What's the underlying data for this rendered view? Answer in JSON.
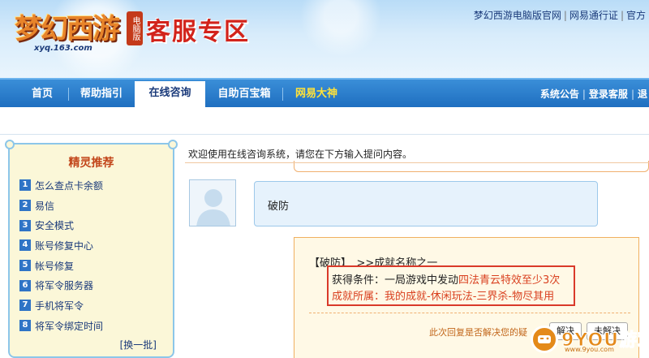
{
  "header": {
    "logo_text": "梦幻西游",
    "logo_badge": "电脑版",
    "logo_url": "xyq.163.com",
    "section_title": "客服专区",
    "top_links": [
      "梦幻西游电脑版官网",
      "网易通行证",
      "官方"
    ]
  },
  "nav": {
    "items": [
      "首页",
      "帮助指引",
      "在线咨询",
      "自助百宝箱",
      "网易大神"
    ],
    "active_index": 2,
    "right_links": [
      "系统公告",
      "登录客服",
      "退"
    ]
  },
  "sidebar": {
    "title": "精灵推荐",
    "items": [
      {
        "num": "1",
        "label": "怎么查点卡余额"
      },
      {
        "num": "2",
        "label": "易信"
      },
      {
        "num": "3",
        "label": "安全模式"
      },
      {
        "num": "4",
        "label": "账号修复中心"
      },
      {
        "num": "5",
        "label": "帐号修复"
      },
      {
        "num": "6",
        "label": "将军令服务器"
      },
      {
        "num": "7",
        "label": "手机将军令"
      },
      {
        "num": "8",
        "label": "将军令绑定时间"
      }
    ],
    "more": "[换一批]"
  },
  "main": {
    "welcome": "欢迎使用在线咨询系统，请您在下方输入提问内容。",
    "user_message": "破防",
    "reply": {
      "head": "【破防】　>>成就名称之一",
      "line1_prefix": "获得条件：一局游戏中发动",
      "line1_highlight": "四法青云特效至少3次",
      "line2": "成就所属：我的成就-休闲玩法-三界杀-物尽其用",
      "feedback": "此次回复是否解决您的疑",
      "btn_solved": "解决",
      "btn_unsolved": "未解决"
    }
  },
  "watermark": {
    "text": "9YOU游戏网",
    "url": "www.9you.com"
  },
  "colors": {
    "nav": "#1f6fc0",
    "accent_red": "#d93a2a",
    "orange": "#f0b060"
  }
}
